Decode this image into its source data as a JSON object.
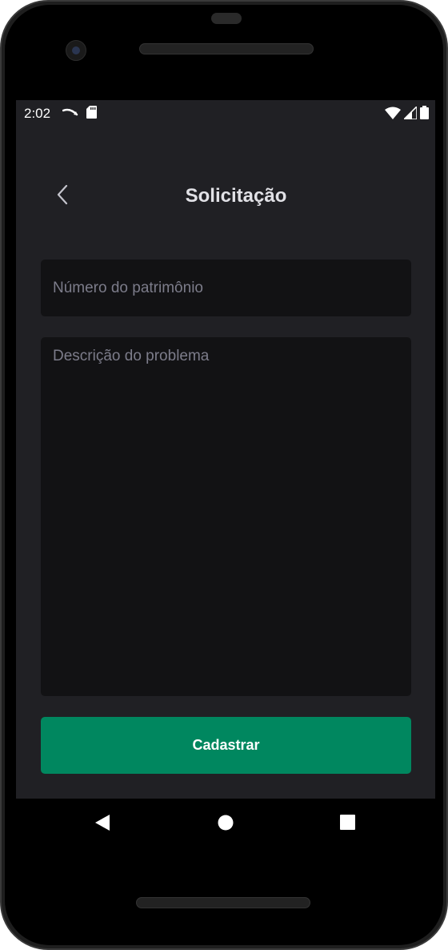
{
  "status_bar": {
    "time": "2:02",
    "icons": [
      "notification-arrow-icon",
      "sd-card-icon",
      "wifi-icon",
      "signal-icon",
      "battery-icon"
    ]
  },
  "header": {
    "title": "Solicitação",
    "back_icon": "chevron-left-icon"
  },
  "form": {
    "patrimonio": {
      "value": "",
      "placeholder": "Número do patrimônio"
    },
    "descricao": {
      "value": "",
      "placeholder": "Descrição do problema"
    },
    "submit_label": "Cadastrar"
  },
  "nav_bar": {
    "icons": [
      "nav-back-icon",
      "nav-home-icon",
      "nav-recents-icon"
    ]
  },
  "colors": {
    "background": "#202024",
    "input_background": "#121214",
    "accent": "#00875f",
    "title_text": "#e1e1e6",
    "placeholder_text": "#7c7c8a"
  }
}
